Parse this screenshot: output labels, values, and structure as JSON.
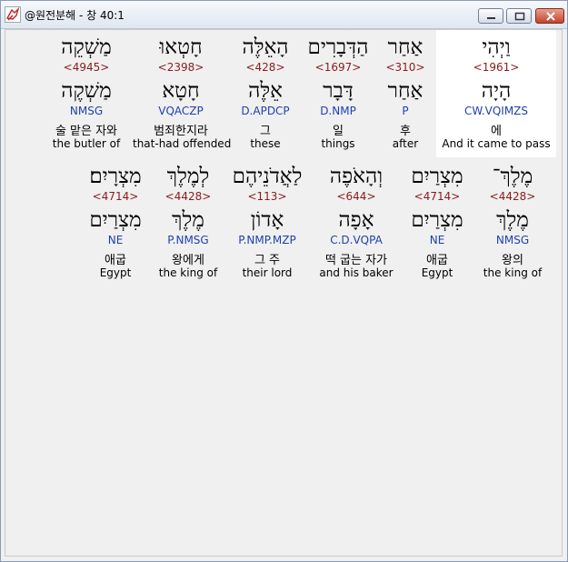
{
  "window": {
    "title": "@원전분해 - 창 40:1",
    "icon": "dove-app-icon"
  },
  "rows": [
    {
      "words": [
        {
          "hebrew": "וַיְהִי",
          "strong": "<1961>",
          "lexeme": "הָיָה",
          "parse": "CW.VQIMZS",
          "korean": "에",
          "english": "And it came to pass",
          "highlight": true
        },
        {
          "hebrew": "אַחַר",
          "strong": "<310>",
          "lexeme": "אַחַר",
          "parse": "P",
          "korean": "후",
          "english": "after"
        },
        {
          "hebrew": "הַדְּבָרִים",
          "strong": "<1697>",
          "lexeme": "דָּבָר",
          "parse": "D.NMP",
          "korean": "일",
          "english": "things"
        },
        {
          "hebrew": "הָאֵלֶּה",
          "strong": "<428>",
          "lexeme": "אֵלֶּה",
          "parse": "D.APDCP",
          "korean": "그",
          "english": "these"
        },
        {
          "hebrew": "חָטְאוּ",
          "strong": "<2398>",
          "lexeme": "חָטָא",
          "parse": "VQACZP",
          "korean": "범죄한지라",
          "english": "that-had offended"
        },
        {
          "hebrew": "מַשְׁקֵה",
          "strong": "<4945>",
          "lexeme": "מַשְׁקֶה",
          "parse": "NMSG",
          "korean": "술 맡은 자와",
          "english": "the butler of"
        }
      ]
    },
    {
      "words": [
        {
          "hebrew": "מֶלֶךְ־",
          "strong": "<4428>",
          "lexeme": "מֶלֶךְ",
          "parse": "NMSG",
          "korean": "왕의",
          "english": "the king of"
        },
        {
          "hebrew": "מִצְרַיִם",
          "strong": "<4714>",
          "lexeme": "מִצְרַיִם",
          "parse": "NE",
          "korean": "애굽",
          "english": "Egypt"
        },
        {
          "hebrew": "וְהָאֹפֶה",
          "strong": "<644>",
          "lexeme": "אָפָה",
          "parse": "C.D.VQPA",
          "korean": "떡 굽는 자가",
          "english": "and his baker"
        },
        {
          "hebrew": "לַאֲדֹנֵיהֶם",
          "strong": "<113>",
          "lexeme": "אָדוֹן",
          "parse": "P.NMP.MZP",
          "korean": "그 주",
          "english": "their lord"
        },
        {
          "hebrew": "לְמֶלֶךְ",
          "strong": "<4428>",
          "lexeme": "מֶלֶךְ",
          "parse": "P.NMSG",
          "korean": "왕에게",
          "english": "the king of"
        },
        {
          "hebrew": "מִצְרָיִם׃",
          "strong": "<4714>",
          "lexeme": "מִצְרַיִם",
          "parse": "NE",
          "korean": "애굽",
          "english": "Egypt"
        }
      ]
    }
  ]
}
